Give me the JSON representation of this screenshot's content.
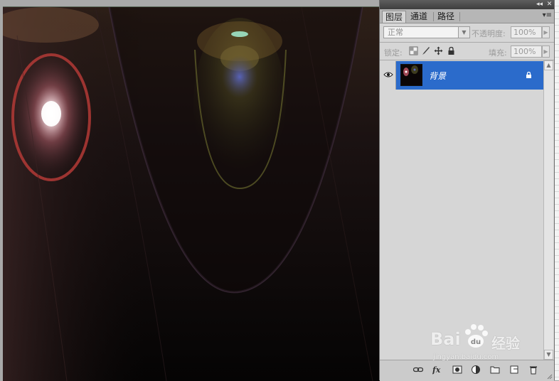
{
  "panel": {
    "tabs": [
      "图层",
      "通道",
      "路径"
    ],
    "collapse_icon": "double-chevron-left-icon",
    "close_icon": "close-icon",
    "menu_icon": "panel-menu-icon"
  },
  "blend_mode": {
    "value": "正常"
  },
  "opacity": {
    "label": "不透明度:",
    "value": "100%"
  },
  "lock": {
    "label": "锁定:",
    "icons": [
      "lock-transparent-pixels-icon",
      "lock-image-pixels-icon",
      "lock-position-icon",
      "lock-all-icon"
    ]
  },
  "fill": {
    "label": "填充:",
    "value": "100%"
  },
  "layers": [
    {
      "name": "背景",
      "visible": true,
      "locked": true,
      "selected": true
    }
  ],
  "bottom_icons": [
    "link-layers-icon",
    "fx-icon",
    "add-mask-icon",
    "adjustment-layer-icon",
    "new-group-icon",
    "new-layer-icon",
    "trash-icon"
  ],
  "watermark": {
    "brand": "Bai",
    "brand_suffix": "经验",
    "url": "jingyan.baidu.com"
  },
  "colors": {
    "selection": "#2b6bcb",
    "panel_bg": "#d6d6d6",
    "canvas_bg": "#0a0707"
  }
}
